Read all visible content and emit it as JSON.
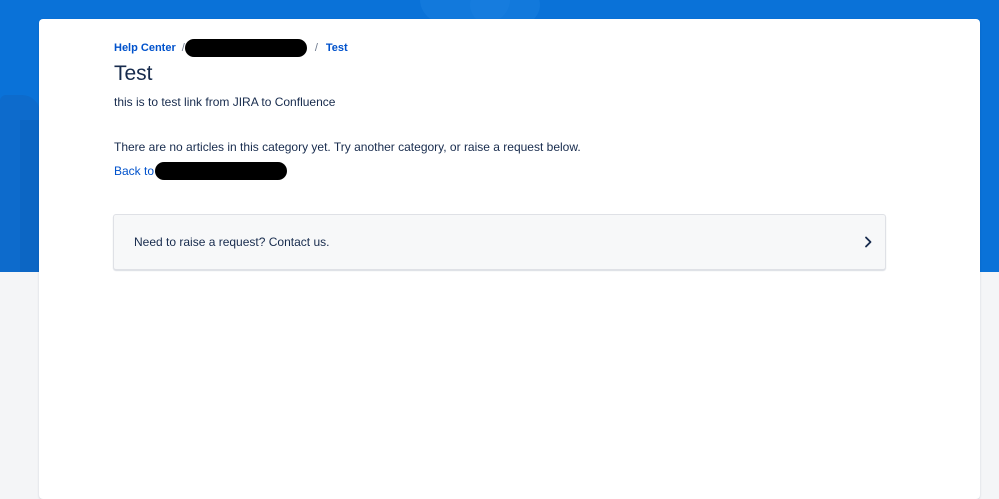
{
  "breadcrumb": {
    "home": "Help Center",
    "separator": "/",
    "current": "Test"
  },
  "category": {
    "title": "Test",
    "description": "this is to test link from JIRA to Confluence",
    "empty_message": "There are no articles in this category yet. Try another category, or raise a request below.",
    "back_label": "Back to"
  },
  "request": {
    "label": "Need to raise a request? Contact us.",
    "icon": "chevron-right-icon"
  },
  "colors": {
    "banner": "#0a72d8",
    "link": "#0052cc",
    "text": "#172b4d"
  }
}
